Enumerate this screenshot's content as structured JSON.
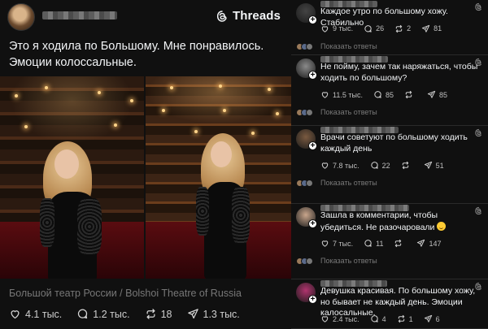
{
  "post": {
    "brand": "Threads",
    "text_line1": "Это я ходила по Большому. Мне понравилось.",
    "text_line2": "Эмоции колоссальные.",
    "caption": "Большой театр России / Bolshoi Theatre of Russia",
    "stats": {
      "likes": "4.1 тыс.",
      "comments": "1.2 тыс.",
      "reposts": "18",
      "shares": "1.3 тыс."
    }
  },
  "replies": [
    {
      "text": "Каждое утро по большому хожу. Стабильно",
      "likes": "9 тыс.",
      "comments": "26",
      "reposts": "2",
      "shares": "81",
      "show_replies": "Показать ответы",
      "avatar_color": "#444"
    },
    {
      "text": "Не пойму, зачем так наряжаться, чтобы ходить по большому?",
      "likes": "11.5 тыс.",
      "comments": "85",
      "reposts": "",
      "shares": "85",
      "show_replies": "Показать ответы",
      "avatar_color": "#8a8a8a"
    },
    {
      "text": "Врачи советуют по большому ходить каждый день",
      "likes": "7.8 тыс.",
      "comments": "22",
      "reposts": "",
      "shares": "51",
      "show_replies": "Показать ответы",
      "avatar_color": "#7a5a40"
    },
    {
      "text": "Зашла в комментарии, чтобы убедиться. Не разочаровали",
      "likes": "7 тыс.",
      "comments": "11",
      "reposts": "",
      "shares": "147",
      "show_replies": "Показать ответы",
      "avatar_color": "#c9a68c"
    },
    {
      "text": "Девушка красивая. По большому хожу, но бывает не каждый день. Эмоции калосальные.",
      "likes": "2.4 тыс.",
      "comments": "4",
      "reposts": "1",
      "shares": "6",
      "avatar_color": "#b0346e"
    }
  ]
}
